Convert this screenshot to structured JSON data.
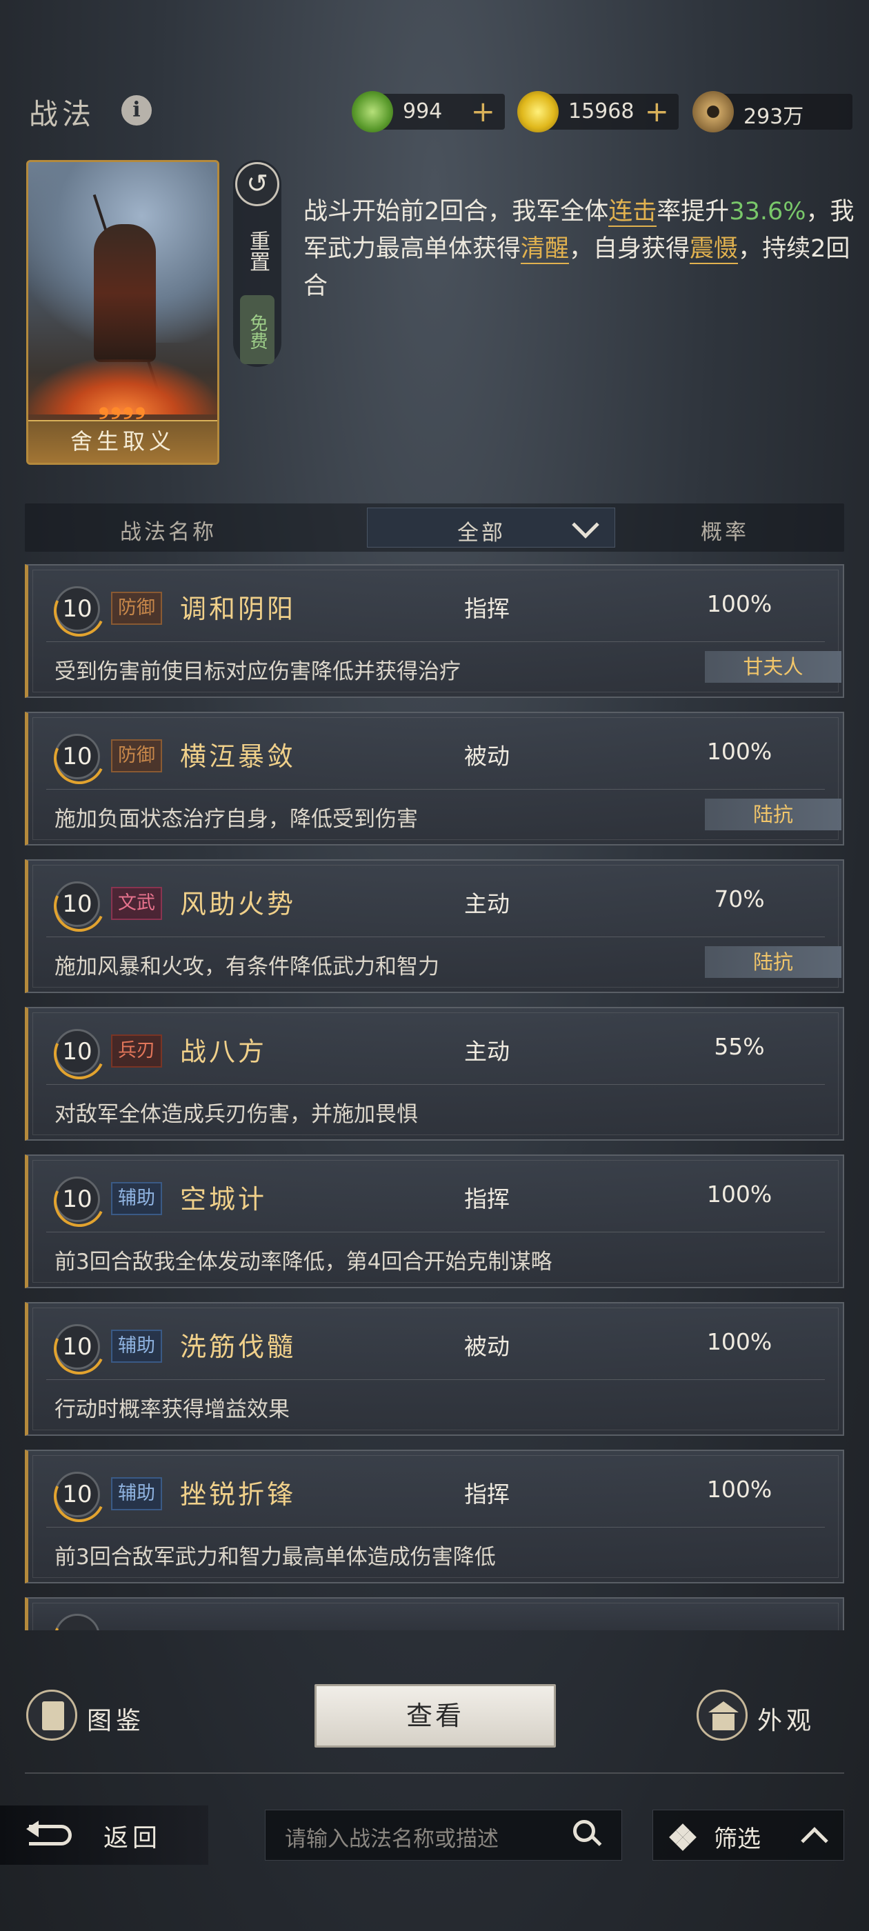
{
  "header": {
    "title": "战法",
    "currencies": [
      {
        "icon": "jade-coin-icon",
        "value": "994",
        "plus": "+"
      },
      {
        "icon": "gold-coin-icon",
        "value": "15968",
        "plus": "+"
      },
      {
        "icon": "copper-coin-icon",
        "value": "293万"
      }
    ]
  },
  "selected": {
    "card_name": "舍生取义",
    "reset_label": "重置",
    "free_label": "免费",
    "description": {
      "p1": "战斗开始前2回合，我军全体",
      "kw1": "连击",
      "p2": "率提升",
      "num": "33.6%",
      "p3": "，我军武力最高单体获得",
      "kw2": "清醒",
      "p4": "，自身获得",
      "kw3": "震慑",
      "p5": "，持续2回合"
    }
  },
  "table": {
    "col_name": "战法名称",
    "filter": "全部",
    "col_prob": "概率",
    "rows": [
      {
        "level": "10",
        "tag": "防御",
        "name": "调和阴阳",
        "type": "指挥",
        "prob": "100%",
        "desc": "受到伤害前使目标对应伤害降低并获得治疗",
        "hero": "甘夫人"
      },
      {
        "level": "10",
        "tag": "防御",
        "name": "横沍暴敛",
        "type": "被动",
        "prob": "100%",
        "desc": "施加负面状态治疗自身，降低受到伤害",
        "hero": "陆抗"
      },
      {
        "level": "10",
        "tag": "文武",
        "name": "风助火势",
        "type": "主动",
        "prob": "70%",
        "desc": "施加风暴和火攻，有条件降低武力和智力",
        "hero": "陆抗"
      },
      {
        "level": "10",
        "tag": "兵刃",
        "name": "战八方",
        "type": "主动",
        "prob": "55%",
        "desc": "对敌军全体造成兵刃伤害，并施加畏惧",
        "hero": ""
      },
      {
        "level": "10",
        "tag": "辅助",
        "name": "空城计",
        "type": "指挥",
        "prob": "100%",
        "desc": "前3回合敌我全体发动率降低，第4回合开始克制谋略",
        "hero": ""
      },
      {
        "level": "10",
        "tag": "辅助",
        "name": "洗筋伐髓",
        "type": "被动",
        "prob": "100%",
        "desc": "行动时概率获得增益效果",
        "hero": ""
      },
      {
        "level": "10",
        "tag": "辅助",
        "name": "挫锐折锋",
        "type": "指挥",
        "prob": "100%",
        "desc": "前3回合敌军武力和智力最高单体造成伤害降低",
        "hero": ""
      }
    ]
  },
  "bottom": {
    "gallery_label": "图鉴",
    "view_label": "查看",
    "appearance_label": "外观",
    "back_label": "返回",
    "search_placeholder": "请输入战法名称或描述",
    "filter_label": "筛选"
  },
  "colors": {
    "accent_gold": "#e2b24f",
    "green": "#79c86a",
    "tag_defense": "#c7874a",
    "tag_civil": "#e7728d",
    "tag_blade": "#e2765a",
    "tag_support": "#8fb3e0"
  }
}
